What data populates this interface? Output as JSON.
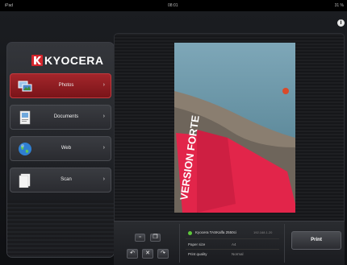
{
  "status_bar": {
    "carrier": "iPad",
    "time": "08:01",
    "battery": "31 %"
  },
  "info_button": "i",
  "brand": {
    "name": "KYOCERA",
    "color": "#d4252c"
  },
  "sidebar": {
    "items": [
      {
        "label": "Photos",
        "icon": "photos-icon",
        "active": true
      },
      {
        "label": "Documents",
        "icon": "documents-icon",
        "active": false
      },
      {
        "label": "Web",
        "icon": "globe-icon",
        "active": false
      },
      {
        "label": "Scan",
        "icon": "scan-icon",
        "active": false
      }
    ],
    "chevron": "›"
  },
  "photo": {
    "banner_text": "VERSION FORTE"
  },
  "toolbar": {
    "rotate_left": "↶",
    "delete": "✕",
    "rotate_right": "↷"
  },
  "printer": {
    "status_color": "#5ec93b",
    "name": "Kyocera TASKalfa 2550ci",
    "address": "192.168.1.20"
  },
  "settings": [
    {
      "label": "Paper size",
      "value": "A4"
    },
    {
      "label": "Print quality",
      "value": "Normal"
    }
  ],
  "print_button": "Print"
}
